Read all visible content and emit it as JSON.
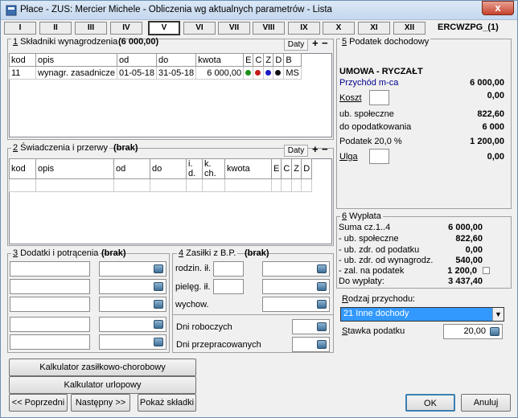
{
  "window": {
    "title": "Płace - ZUS: Mercier Michele - Obliczenia wg aktualnych parametrów  - Lista",
    "close": "x"
  },
  "tabs": [
    "I",
    "II",
    "III",
    "IV",
    "V",
    "VI",
    "VII",
    "VIII",
    "IX",
    "X",
    "XI",
    "XII"
  ],
  "code": "ERCWZPG_(1)",
  "sec1": {
    "num": "1",
    "title": " Składniki wynagrodzenia",
    "total": "(6 000,00)",
    "daty": "Daty",
    "plus": "+",
    "minus": "−",
    "headers": [
      "kod",
      "opis",
      "od",
      "do",
      "kwota",
      "E",
      "C",
      "Z",
      "D",
      "B"
    ],
    "rows": [
      {
        "kod": "11",
        "opis": "wynagr. zasadnicze",
        "od": "01-05-18",
        "do": "31-05-18",
        "kwota": "6 000,00",
        "b": "MS"
      }
    ],
    "dot_colors": [
      "#1a8f1a",
      "#c41a1a",
      "#1a1ac4",
      "#111111"
    ]
  },
  "sec2": {
    "num": "2",
    "title": " Świadczenia i przerwy",
    "total": "(brak)",
    "daty": "Daty",
    "plus": "+",
    "minus": "−",
    "headers": [
      "kod",
      "opis",
      "od",
      "do",
      "i. d.",
      "k. ch.",
      "kwota",
      "E",
      "C",
      "Z",
      "D"
    ]
  },
  "sec3": {
    "num": "3",
    "title": " Dodatki i potrącenia",
    "total": "(brak)"
  },
  "sec4": {
    "num": "4",
    "title": " Zasiłki z B.P.",
    "total": "(brak)",
    "rodzin": "rodzin. ił.",
    "pieleg": "pielęg. ił.",
    "wychow": "wychow.",
    "dni_rob": "Dni roboczych",
    "dni_prz": "Dni przepracowanych"
  },
  "sec5": {
    "num": "5",
    "title": " Podatek dochodowy",
    "umowa": "UMOWA - RYCZAŁT",
    "przychod": "Przychód m-ca",
    "przychod_val": "6 000,00",
    "koszt": "Koszt",
    "koszt_val": "0,00",
    "spol": "ub. społeczne",
    "spol_val": "822,60",
    "do_opod": "do opodatkowania",
    "do_opod_val": "6 000",
    "podatek": "Podatek 20,0 %",
    "podatek_val": "1 200,00",
    "ulga": "Ulga",
    "ulga_val": "0,00"
  },
  "sec6": {
    "num": "6",
    "title": " Wypłata",
    "suma": "Suma cz.1..4",
    "suma_val": "6 000,00",
    "spol": "- ub. społeczne",
    "spol_val": "822,60",
    "zdr_pod": "- ub. zdr. od podatku",
    "zdr_pod_val": "0,00",
    "zdr_wyn": "- ub. zdr. od wynagrodz.",
    "zdr_wyn_val": "540,00",
    "zal": "- zal. na podatek",
    "zal_val": "1 200,0",
    "do_wyp": "Do wypłaty:",
    "do_wyp_val": "3 437,40"
  },
  "rodzaj": {
    "label": "Rodzaj przychodu:",
    "value": "21 Inne dochody"
  },
  "stawka": {
    "label": "Stawka podatku",
    "value": "20,00"
  },
  "buttons": {
    "kalk_zas": "Kalkulator zasiłkowo-chorobowy",
    "kalk_url": "Kalkulator urlopowy",
    "prev": "<< Poprzedni",
    "next": "Następny >>",
    "pokaz": "Pokaż składki",
    "ok": "OK",
    "anuluj": "Anuluj"
  }
}
